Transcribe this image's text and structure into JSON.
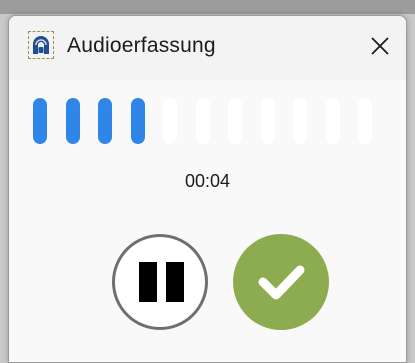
{
  "window": {
    "title": "Audioerfassung",
    "app_icon": "audio-recorder-app-icon",
    "close_icon": "close-icon"
  },
  "recorder": {
    "level_meter": {
      "total_bars": 11,
      "active_bars": 4,
      "active_color": "#2f86e8",
      "inactive_color": "#ffffff"
    },
    "elapsed_time": "00:04",
    "pause_icon": "pause-icon",
    "confirm_icon": "checkmark-icon",
    "confirm_color": "#8dab4f"
  }
}
